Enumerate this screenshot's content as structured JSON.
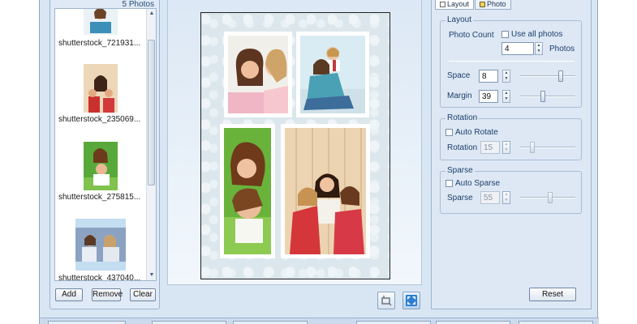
{
  "photo_panel": {
    "count_label": "5 Photos",
    "items": [
      {
        "name": "shutterstock_721931..."
      },
      {
        "name": "shutterstock_235069..."
      },
      {
        "name": "shutterstock_275815..."
      },
      {
        "name": "shutterstock_437040..."
      }
    ],
    "add_label": "Add",
    "remove_label": "Remove",
    "clear_label": "Clear"
  },
  "tabs": [
    {
      "label": "Layout",
      "icon": "layout-icon"
    },
    {
      "label": "Photo",
      "icon": "photo-icon"
    }
  ],
  "layout_group": {
    "title": "Layout",
    "photo_count_label": "Photo Count",
    "use_all_label": "Use all photos",
    "use_all_checked": false,
    "photo_count_value": "4",
    "photos_unit": "Photos",
    "space_label": "Space",
    "space_value": "8",
    "space_slider": 0.75,
    "margin_label": "Margin",
    "margin_value": "39",
    "margin_slider": 0.4
  },
  "rotation_group": {
    "title": "Rotation",
    "auto_rotate_label": "Auto Rotate",
    "auto_rotate_checked": false,
    "rotation_label": "Rotation",
    "rotation_value": "15",
    "rotation_slider": 0.2
  },
  "sparse_group": {
    "title": "Sparse",
    "auto_sparse_label": "Auto Sparse",
    "auto_sparse_checked": false,
    "sparse_label": "Sparse",
    "sparse_value": "55",
    "sparse_slider": 0.55
  },
  "reset_label": "Reset",
  "colors": {
    "panel_bg": "#dde8f4",
    "border": "#9db3cc",
    "label_text": "#1d3f6b"
  }
}
